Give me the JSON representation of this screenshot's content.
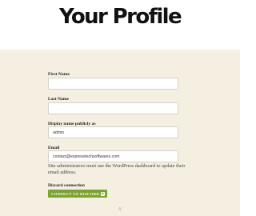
{
  "page": {
    "title": "Your Profile",
    "background": "#f4efe1",
    "accent": "#7ca432"
  },
  "form": {
    "first_name": {
      "label": "First Name",
      "value": ""
    },
    "last_name": {
      "label": "Last Name",
      "value": ""
    },
    "display_name": {
      "label": "Display name publicly as",
      "value": "admin"
    },
    "email": {
      "label": "Email",
      "value": "contact@expresstechsoftwares.com",
      "help": "Site administrators must use the WordPress dashboard to update their email address."
    },
    "discord": {
      "label": "Discord connection",
      "button_label": "CONNECT TO DISCORD",
      "button_icon": "discord-icon"
    }
  },
  "footer": {
    "separator": "//"
  }
}
